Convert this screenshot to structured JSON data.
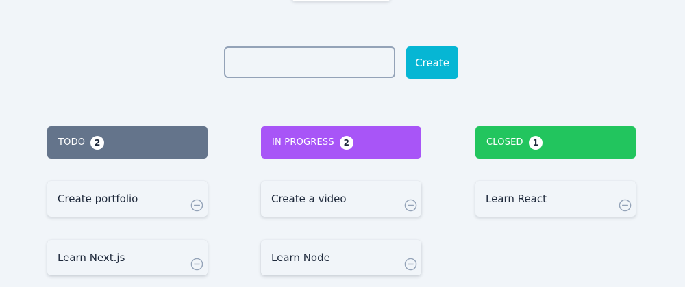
{
  "colors": {
    "background": "#f1f5f9",
    "accent": "#06b6d4",
    "todo": "#64748b",
    "in_progress": "#a855f7",
    "closed": "#22c55e",
    "icon": "#94a3b8"
  },
  "form": {
    "input_value": "",
    "input_placeholder": "",
    "create_label": "Create"
  },
  "columns": [
    {
      "title": "TODO",
      "count": "2",
      "color": "#64748b",
      "tasks": [
        {
          "label": "Create portfolio",
          "icon": "minus-circle-icon"
        },
        {
          "label": "Learn Next.js",
          "icon": "minus-circle-icon"
        }
      ]
    },
    {
      "title": "IN PROGRESS",
      "count": "2",
      "color": "#a855f7",
      "tasks": [
        {
          "label": "Create a video",
          "icon": "minus-circle-icon"
        },
        {
          "label": "Learn Node",
          "icon": "minus-circle-icon"
        }
      ]
    },
    {
      "title": "CLOSED",
      "count": "1",
      "color": "#22c55e",
      "tasks": [
        {
          "label": "Learn React",
          "icon": "minus-circle-icon"
        }
      ]
    }
  ]
}
